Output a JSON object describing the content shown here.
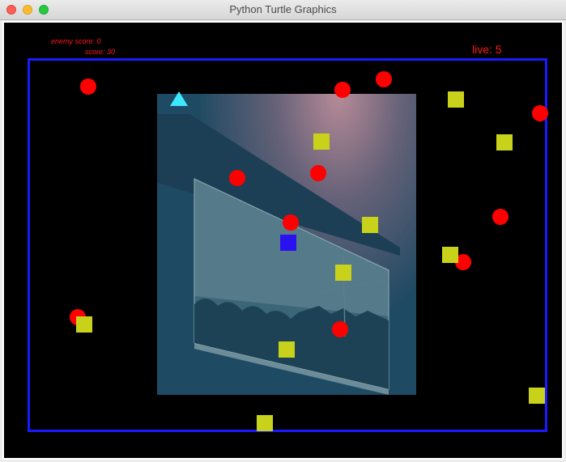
{
  "window": {
    "title": "Python Turtle Graphics"
  },
  "hud": {
    "enemy_score": "enemy score: 0",
    "score": "score: 30",
    "lives": "live: 5"
  },
  "colors": {
    "border": "#1a1aff",
    "enemy": "#ff0000",
    "food": "#c8d21a",
    "player": "#2a12f0",
    "turtle": "#3ee8ff",
    "hud_text": "#ff1a1a"
  }
}
